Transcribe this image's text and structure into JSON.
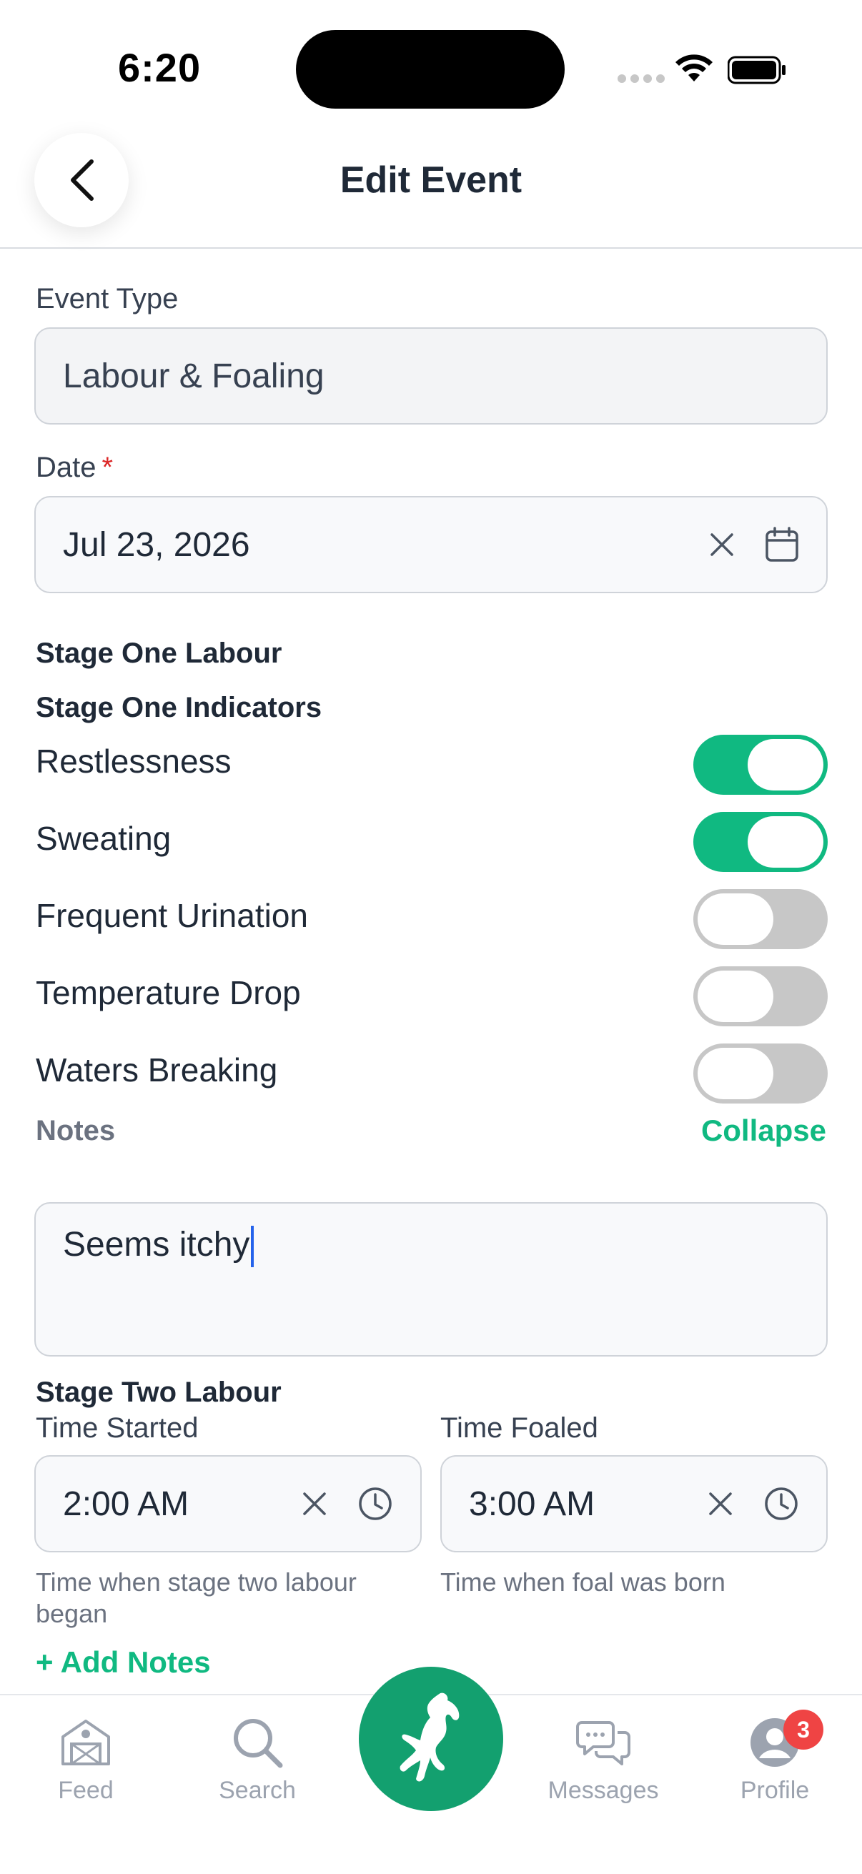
{
  "status_bar": {
    "time": "6:20"
  },
  "header": {
    "title": "Edit Event"
  },
  "event_type": {
    "label": "Event Type",
    "value": "Labour & Foaling"
  },
  "date": {
    "label": "Date",
    "required_mark": "*",
    "value": "Jul 23, 2026"
  },
  "stage_one": {
    "heading": "Stage One Labour",
    "indicators_heading": "Stage One Indicators",
    "indicators": [
      {
        "label": "Restlessness",
        "on": true
      },
      {
        "label": "Sweating",
        "on": true
      },
      {
        "label": "Frequent Urination",
        "on": false
      },
      {
        "label": "Temperature Drop",
        "on": false
      },
      {
        "label": "Waters Breaking",
        "on": false
      }
    ],
    "notes_label": "Notes",
    "collapse_label": "Collapse",
    "notes_value": "Seems itchy"
  },
  "stage_two": {
    "heading": "Stage Two Labour",
    "time_started": {
      "label": "Time Started",
      "value": "2:00 AM",
      "helper": "Time when stage two labour began"
    },
    "time_foaled": {
      "label": "Time Foaled",
      "value": "3:00 AM",
      "helper": "Time when foal was born"
    },
    "add_notes_label": "+ Add Notes"
  },
  "tab_bar": {
    "items": [
      {
        "label": "Feed",
        "icon": "barn-icon"
      },
      {
        "label": "Search",
        "icon": "search-icon"
      },
      {
        "label": "",
        "icon": "horse-icon"
      },
      {
        "label": "Messages",
        "icon": "chat-icon"
      },
      {
        "label": "Profile",
        "icon": "profile-icon"
      }
    ],
    "profile_badge": "3"
  },
  "colors": {
    "accent": "#10b981",
    "fab": "#13a06f",
    "badge": "#ef4444",
    "required": "#dc2626"
  }
}
